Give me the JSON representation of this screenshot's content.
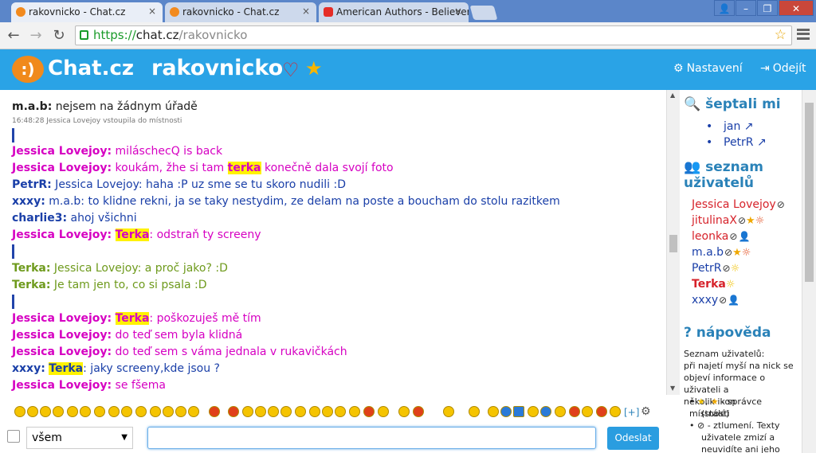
{
  "browser": {
    "tabs": [
      {
        "title": "rakovnicko - Chat.cz",
        "close": "×"
      },
      {
        "title": "rakovnicko - Chat.cz",
        "close": "×"
      },
      {
        "title": "American Authors - Believer",
        "close": "×"
      }
    ],
    "url_scheme": "https://",
    "url_host": "chat.cz",
    "url_path": "/rakovnicko"
  },
  "header": {
    "logo_glyph": ":)",
    "logo_text": "Chat.cz",
    "room": "rakovnicko",
    "settings_label": "Nastavení",
    "logout_label": "Odejít"
  },
  "messages": [
    {
      "nick": "m.a.b:",
      "text": " nejsem na žádnym úřadě"
    },
    {
      "system": "16:48:28 Jessica Lovejoy vstoupila do místnosti"
    },
    {
      "nick": "Jessica Lovejoy:",
      "text": " miláschecQ is back"
    },
    {
      "nick": "Jessica Lovejoy:",
      "pre": " koukám, žhe si tam ",
      "hl": "terka",
      "post": " konečně dala svojí foto"
    },
    {
      "nick": "PetrR:",
      "text": " Jessica Lovejoy: haha :P uz sme se tu skoro nudili :D"
    },
    {
      "nick": "xxxy:",
      "text": " m.a.b: to klidne rekni, ja se taky nestydim, ze delam na poste a boucham do stolu razitkem"
    },
    {
      "nick": "charlie3:",
      "text": " ahoj všichni"
    },
    {
      "nick": "Jessica Lovejoy:",
      "pre": " ",
      "hl": "Terka",
      "post": ": odstraň ty screeny"
    },
    {
      "nick": "Terka:",
      "text": " Jessica Lovejoy: a proč jako? :D"
    },
    {
      "nick": "Terka:",
      "text": " Je tam jen to, co si psala :D"
    },
    {
      "nick": "Jessica Lovejoy:",
      "pre": " ",
      "hl": "Terka",
      "post": ": poškozuješ mě tím"
    },
    {
      "nick": "Jessica Lovejoy:",
      "text": " do teď sem byla klidná"
    },
    {
      "nick": "Jessica Lovejoy:",
      "text": " do teď sem s váma jednala v rukavičkách"
    },
    {
      "nick": "xxxy:",
      "pre": " ",
      "hl": "Terka",
      "post": ": jaky screeny,kde jsou ?"
    },
    {
      "nick": "Jessica Lovejoy:",
      "text": " se fšema"
    }
  ],
  "sidebar": {
    "whispers_title": "šeptali mi",
    "whispers": [
      "jan",
      "PetrR"
    ],
    "users_title_1": "seznam",
    "users_title_2": "uživatelů",
    "users": [
      "Jessica Lovejoy",
      "jitulinaX",
      "leonka",
      "m.a.b",
      "PetrR",
      "Terka",
      "xxxy"
    ],
    "help_title": "nápověda",
    "help_lines": [
      "Seznam uživatelů:",
      "při najetí myší na nick se",
      "objeví informace o uživateli a",
      "několik ikon"
    ],
    "help_item_1a": "- správce místnosti",
    "help_item_1b": "(stálé)",
    "help_item_2a": "- ztlumení. Texty",
    "help_item_2b": "uživatele zmizí a",
    "help_item_2c": "neuvidíte ani jeho šeptání."
  },
  "composer": {
    "recipient": "všem",
    "send_label": "Odeslat",
    "more_label": "[+]"
  },
  "colors": {
    "header_bg": "#2aa3e6",
    "highlight": "#fff200",
    "jessica": "#d600c2",
    "terka": "#6e9a1c",
    "blue_nick": "#1a3fa8"
  }
}
